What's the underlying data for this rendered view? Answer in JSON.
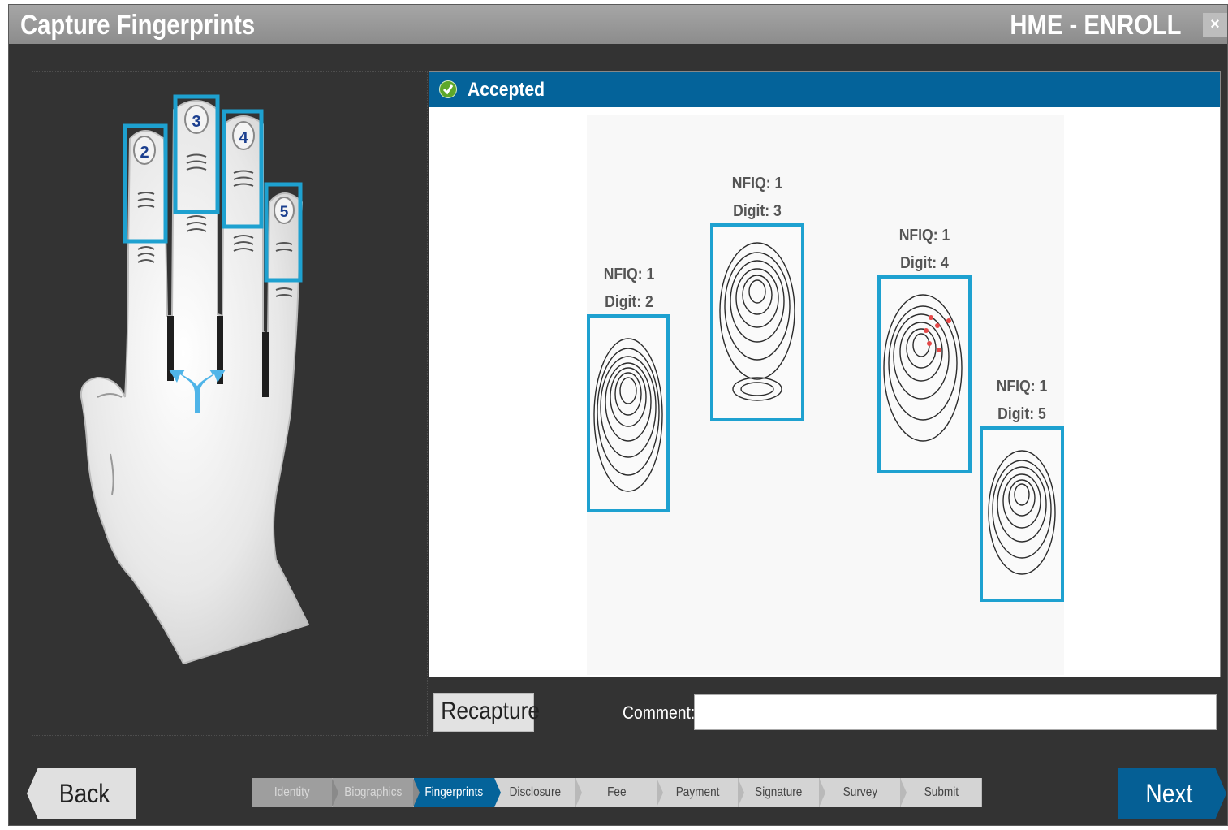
{
  "window": {
    "title": "Capture Fingerprints",
    "app_name": "HME - ENROLL",
    "close_label": "×"
  },
  "hand": {
    "fingers": [
      {
        "label": "2"
      },
      {
        "label": "3"
      },
      {
        "label": "4"
      },
      {
        "label": "5"
      }
    ],
    "highlight_color": "#1ea1d0",
    "palm_icon": "split-arrow-icon"
  },
  "result": {
    "status": "Accepted",
    "status_icon": "check-icon",
    "header_color": "#04639a",
    "prints": [
      {
        "nfiq": "NFIQ: 1",
        "digit": "Digit: 2"
      },
      {
        "nfiq": "NFIQ: 1",
        "digit": "Digit: 3"
      },
      {
        "nfiq": "NFIQ: 1",
        "digit": "Digit: 4"
      },
      {
        "nfiq": "NFIQ: 1",
        "digit": "Digit: 5"
      }
    ]
  },
  "actions": {
    "recapture_label": "Recapture",
    "comment_label": "Comment:",
    "comment_value": ""
  },
  "nav": {
    "back_label": "Back",
    "next_label": "Next",
    "steps": [
      {
        "label": "Identity",
        "state": "done"
      },
      {
        "label": "Biographics",
        "state": "done"
      },
      {
        "label": "Fingerprints",
        "state": "active"
      },
      {
        "label": "Disclosure",
        "state": "pending"
      },
      {
        "label": "Fee",
        "state": "pending"
      },
      {
        "label": "Payment",
        "state": "pending"
      },
      {
        "label": "Signature",
        "state": "pending"
      },
      {
        "label": "Survey",
        "state": "pending"
      },
      {
        "label": "Submit",
        "state": "pending"
      }
    ]
  }
}
